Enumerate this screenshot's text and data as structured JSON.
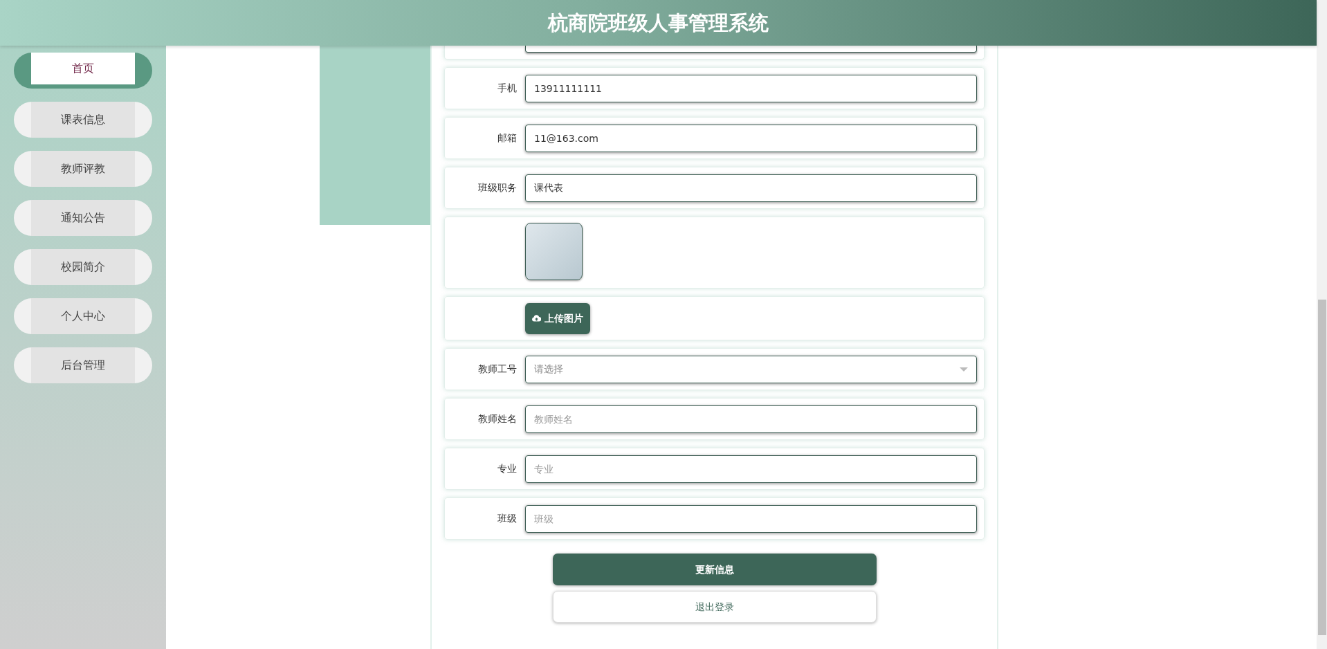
{
  "header": {
    "title": "杭商院班级人事管理系统"
  },
  "sidebar": {
    "items": [
      {
        "label": "首页",
        "selected": true
      },
      {
        "label": "课表信息",
        "selected": false
      },
      {
        "label": "教师评教",
        "selected": false
      },
      {
        "label": "通知公告",
        "selected": false
      },
      {
        "label": "校园简介",
        "selected": false
      },
      {
        "label": "个人中心",
        "selected": false
      },
      {
        "label": "后台管理",
        "selected": false
      }
    ]
  },
  "form": {
    "rows": [
      {
        "kind": "input"
      },
      {
        "kind": "input",
        "label": "手机",
        "value": "13911111111"
      },
      {
        "kind": "input",
        "label": "邮箱",
        "value": "11@163.com"
      },
      {
        "kind": "input",
        "label": "班级职务",
        "value": "课代表"
      },
      {
        "kind": "photo"
      },
      {
        "kind": "upload",
        "button": "上传图片"
      },
      {
        "kind": "select",
        "label": "教师工号",
        "placeholder": "请选择"
      },
      {
        "kind": "input",
        "label": "教师姓名",
        "placeholder": "教师姓名"
      },
      {
        "kind": "input",
        "label": "专业",
        "placeholder": "专业"
      },
      {
        "kind": "input",
        "label": "班级",
        "placeholder": "班级"
      }
    ]
  },
  "buttons": [
    {
      "kind": "primary",
      "label": "更新信息"
    },
    {
      "kind": "secondary",
      "label": "退出登录"
    }
  ]
}
